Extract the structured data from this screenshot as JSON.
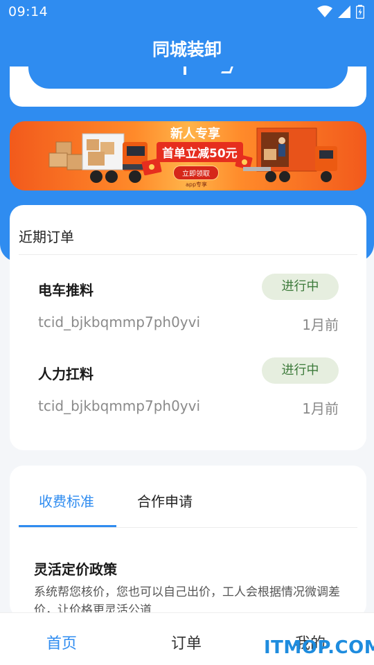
{
  "status_bar": {
    "time": "09:14"
  },
  "header": {
    "title": "同城装卸"
  },
  "banner": {
    "headline": "新人专享",
    "offer": "首单立减50元",
    "button": "立即领取",
    "note": "app专享"
  },
  "recent_orders": {
    "title": "近期订单",
    "items": [
      {
        "service": "电车推料",
        "status": "进行中",
        "order_id": "tcid_bjkbqmmp7ph0yvi",
        "time": "1月前"
      },
      {
        "service": "人力扛料",
        "status": "进行中",
        "order_id": "tcid_bjkbqmmp7ph0yvi",
        "time": "1月前"
      }
    ]
  },
  "pricing": {
    "tabs": [
      "收费标准",
      "合作申请"
    ],
    "active_tab": 0,
    "policy_title": "灵活定价政策",
    "policy_desc": "系统帮您核价，您也可以自己出价，工人会根据情况微调差价，让价格更灵活公道"
  },
  "bottom_nav": {
    "items": [
      "首页",
      "订单",
      "我的"
    ],
    "active": 0
  },
  "watermark": "ITMOP.COM",
  "colors": {
    "primary": "#2f8cf0",
    "badge_bg": "#e6eedf",
    "badge_text": "#3c7a3a",
    "banner": "#ff8a2a"
  }
}
